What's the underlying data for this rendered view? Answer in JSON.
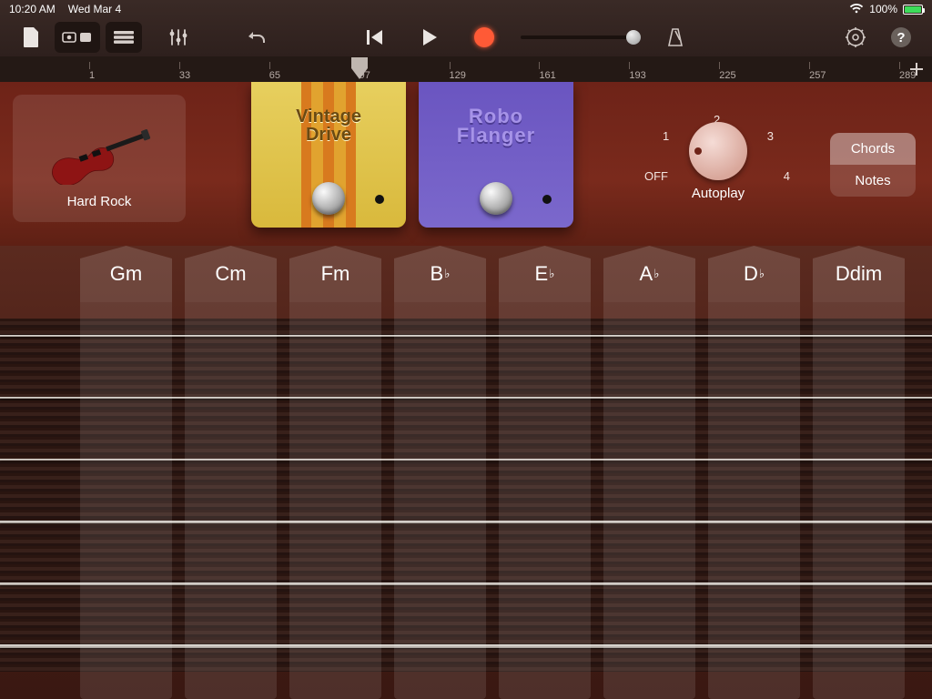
{
  "status": {
    "time": "10:20 AM",
    "date": "Wed Mar 4",
    "battery_pct": "100%"
  },
  "ruler": {
    "ticks": [
      "1",
      "33",
      "65",
      "97",
      "129",
      "161",
      "193",
      "225",
      "257",
      "289"
    ],
    "playhead_index": 3
  },
  "instrument": {
    "name": "Hard Rock"
  },
  "pedals": [
    {
      "id": "vintage-drive",
      "label_line1": "Vintage",
      "label_line2": "Drive"
    },
    {
      "id": "robo-flanger",
      "label_line1": "Robo",
      "label_line2": "Flanger"
    }
  ],
  "autoplay": {
    "caption": "Autoplay",
    "marks": {
      "off": "OFF",
      "m1": "1",
      "m2": "2",
      "m3": "3",
      "m4": "4"
    }
  },
  "mode": {
    "chords": "Chords",
    "notes": "Notes",
    "selected": "chords"
  },
  "chords": [
    "Gm",
    "Cm",
    "Fm",
    "B♭",
    "E♭",
    "A♭",
    "D♭",
    "Ddim"
  ],
  "strings": 6
}
